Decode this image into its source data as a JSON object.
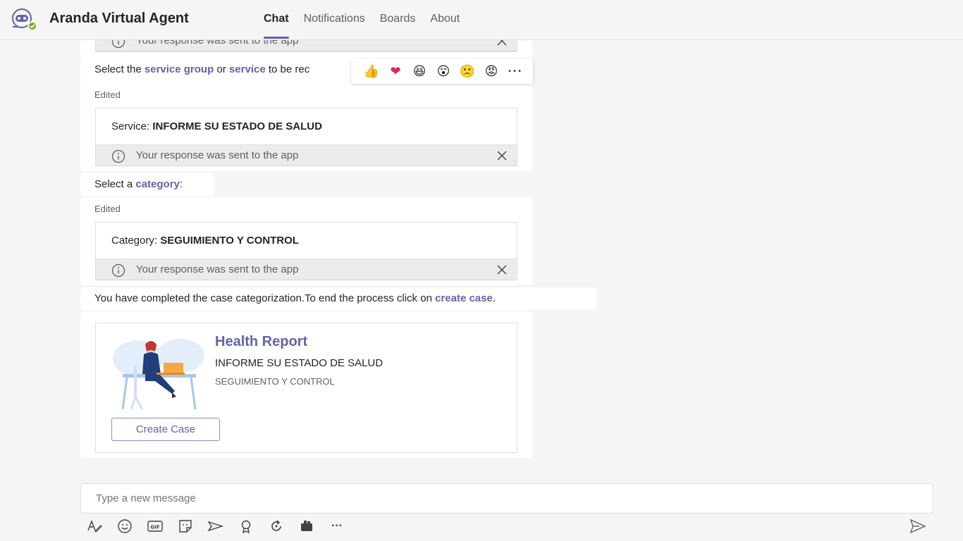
{
  "header": {
    "app_title": "Aranda Virtual Agent",
    "tabs": [
      {
        "label": "Chat",
        "active": true
      },
      {
        "label": "Notifications",
        "active": false
      },
      {
        "label": "Boards",
        "active": false
      },
      {
        "label": "About",
        "active": false
      }
    ]
  },
  "messages": {
    "notice_text": "Your response was sent to the app",
    "m1": {
      "prefix": "Select the ",
      "link1": "service group",
      "middle": " or ",
      "link2": "service",
      "suffix": " to be rec"
    },
    "edited_label": "Edited",
    "service_card": {
      "label": "Service: ",
      "value": "INFORME SU ESTADO DE SALUD"
    },
    "m2": {
      "prefix": "Select a ",
      "link": "category",
      "suffix": ":"
    },
    "category_card": {
      "label": "Category: ",
      "value": "SEGUIMIENTO Y CONTROL"
    },
    "m3": {
      "prefix": "You have completed the case categorization.To end the process click on ",
      "link": "create case",
      "suffix": "."
    },
    "health_card": {
      "title": "Health Report",
      "subtitle": "INFORME SU ESTADO DE SALUD",
      "detail": "SEGUIMIENTO Y CONTROL",
      "button": "Create Case"
    }
  },
  "reactions": [
    {
      "name": "like-reaction-icon",
      "glyph": "👍"
    },
    {
      "name": "heart-reaction-icon",
      "glyph": "❤"
    },
    {
      "name": "laugh-reaction-icon",
      "glyph": "😆"
    },
    {
      "name": "surprised-reaction-icon",
      "glyph": "😮"
    },
    {
      "name": "sad-reaction-icon",
      "glyph": "🙁"
    },
    {
      "name": "angry-reaction-icon",
      "glyph": "😡"
    }
  ],
  "reactions_more": "···",
  "compose": {
    "placeholder": "Type a new message"
  },
  "toolbar_more": "···",
  "colors": {
    "brand": "#6264a7",
    "background": "#f5f5f5"
  }
}
